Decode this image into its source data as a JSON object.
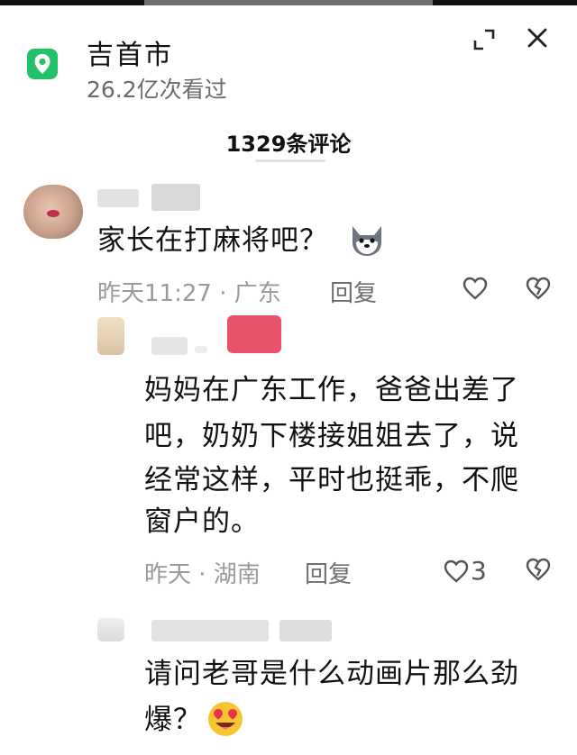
{
  "header": {
    "location_title": "吉首市",
    "views": "26.2亿次看过",
    "comment_count": "1329条评论"
  },
  "icons": {
    "location": "map-pin-icon",
    "expand": "expand-icon",
    "close": "close-icon",
    "like": "heart-icon",
    "dislike": "broken-heart-icon"
  },
  "comments": [
    {
      "text": "家长在打麻将吧？",
      "time": "昨天11:27 · 广东",
      "reply": "回复",
      "likes": "",
      "emoji": "shiba-dog-emoji"
    },
    {
      "text_lines": [
        "妈妈在广东工作，爸爸出差了",
        "吧，奶奶下楼接姐姐去了，说",
        "经常这样，平时也挺乖，不爬",
        "窗户的。"
      ],
      "time": "昨天 · 湖南",
      "reply": "回复",
      "likes": "3"
    },
    {
      "text_lines": [
        "请问老哥是什么动画片那么劲",
        "爆？"
      ],
      "emoji": "heart-eyes-emoji"
    }
  ],
  "colors": {
    "accent_green": "#23c16a",
    "meta_gray": "#9a9a9a",
    "blur_red": "#e8526a"
  }
}
